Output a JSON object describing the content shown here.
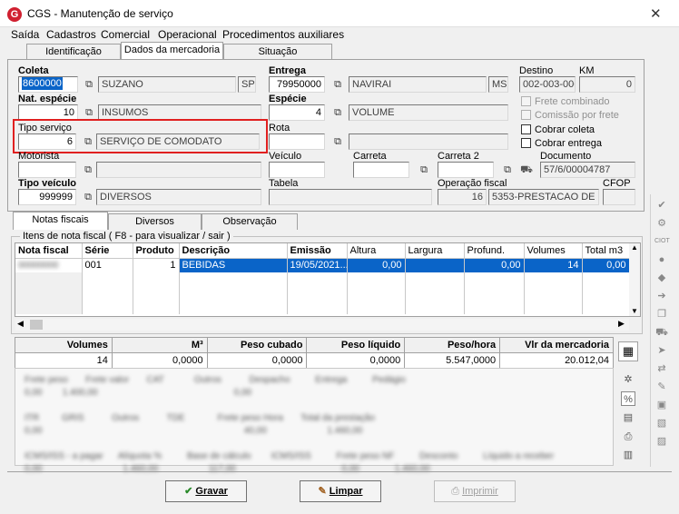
{
  "window": {
    "title": "CGS - Manutenção de serviço",
    "close_glyph": "✕"
  },
  "menu": [
    "Saída",
    "Cadastros",
    "Comercial",
    "Operacional",
    "Procedimentos auxiliares"
  ],
  "top_tabs": [
    "Identificação",
    "Dados da mercadoria",
    "Situação"
  ],
  "form": {
    "coleta": {
      "label": "Coleta",
      "code": "8600000",
      "name": "SUZANO",
      "uf": "SP"
    },
    "entrega": {
      "label": "Entrega",
      "code": "79950000",
      "name": "NAVIRAI",
      "uf": "MS"
    },
    "destino": {
      "label": "Destino",
      "value": "002-003-006"
    },
    "km": {
      "label": "KM",
      "value": "0"
    },
    "nat_especie": {
      "label": "Nat. espécie",
      "code": "10",
      "name": "INSUMOS"
    },
    "especie": {
      "label": "Espécie",
      "code": "4",
      "name": "VOLUME"
    },
    "frete_combinado": "Frete combinado",
    "comissao_frete": "Comissão por frete",
    "cobrar_coleta": "Cobrar coleta",
    "cobrar_entrega": "Cobrar entrega",
    "tipo_servico": {
      "label": "Tipo serviço",
      "code": "6",
      "name": "SERVIÇO DE COMODATO"
    },
    "rota": {
      "label": "Rota"
    },
    "motorista": {
      "label": "Motorista"
    },
    "veiculo": {
      "label": "Veículo"
    },
    "carreta": {
      "label": "Carreta"
    },
    "carreta2": {
      "label": "Carreta 2"
    },
    "documento": {
      "label": "Documento",
      "value": "57/6/00004787"
    },
    "tipo_veiculo": {
      "label": "Tipo veículo",
      "code": "999999",
      "name": "DIVERSOS"
    },
    "tabela": {
      "label": "Tabela"
    },
    "operacao_fiscal": {
      "label": "Operação fiscal",
      "code": "16",
      "name": "5353-PRESTACAO DE SE"
    },
    "cfop": {
      "label": "CFOP"
    }
  },
  "sub_tabs": [
    "Notas fiscais",
    "Diversos",
    "Observação"
  ],
  "itens_group": "Itens de nota fiscal ( F8 - para visualizar / sair )",
  "grid": {
    "columns": [
      "Nota fiscal",
      "Série",
      "Produto",
      "Descrição",
      "Emissão",
      "Altura",
      "Largura",
      "Profund.",
      "Volumes",
      "Total m3"
    ],
    "rows": [
      {
        "nota": "",
        "serie": "001",
        "produto": "1",
        "descricao": "BEBIDAS",
        "emissao": "19/05/2021...",
        "altura": "0,00",
        "largura": "",
        "profund": "0,00",
        "volumes": "14",
        "total_m3": "0,00"
      }
    ]
  },
  "totals": {
    "headers": [
      "Volumes",
      "M³",
      "Peso cubado",
      "Peso líquido",
      "Peso/hora",
      "Vlr da mercadoria"
    ],
    "values": [
      "14",
      "0,0000",
      "0,0000",
      "0,0000",
      "5.547,0000",
      "20.012,04"
    ]
  },
  "buttons": {
    "gravar": "Gravar",
    "limpar": "Limpar",
    "imprimir": "Imprimir"
  },
  "colors": {
    "selection": "#0a64c8",
    "highlight_box": "#e02020",
    "logo": "#d02030"
  }
}
